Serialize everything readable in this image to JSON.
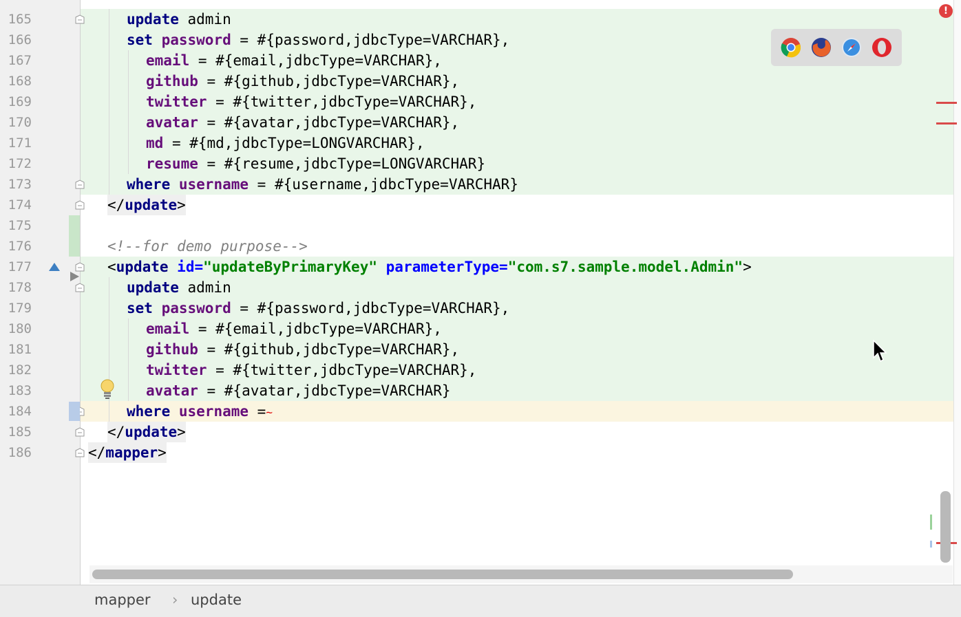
{
  "lines": [
    {
      "n": "165",
      "bg": "hl",
      "indent": 2,
      "tokens": [
        {
          "t": "update",
          "c": "kw"
        },
        {
          "t": " admin",
          "c": ""
        }
      ]
    },
    {
      "n": "166",
      "bg": "hl",
      "indent": 2,
      "tokens": [
        {
          "t": "set",
          "c": "kw"
        },
        {
          "t": " ",
          "c": ""
        },
        {
          "t": "password",
          "c": "col"
        },
        {
          "t": " = #{password,jdbcType=VARCHAR},",
          "c": ""
        }
      ]
    },
    {
      "n": "167",
      "bg": "hl",
      "indent": 3,
      "tokens": [
        {
          "t": "email",
          "c": "col"
        },
        {
          "t": " = #{email,jdbcType=VARCHAR},",
          "c": ""
        }
      ]
    },
    {
      "n": "168",
      "bg": "hl",
      "indent": 3,
      "tokens": [
        {
          "t": "github",
          "c": "col"
        },
        {
          "t": " = #{github,jdbcType=VARCHAR},",
          "c": ""
        }
      ]
    },
    {
      "n": "169",
      "bg": "hl",
      "indent": 3,
      "tokens": [
        {
          "t": "twitter",
          "c": "col"
        },
        {
          "t": " = #{twitter,jdbcType=VARCHAR},",
          "c": ""
        }
      ]
    },
    {
      "n": "170",
      "bg": "hl",
      "indent": 3,
      "tokens": [
        {
          "t": "avatar",
          "c": "col"
        },
        {
          "t": " = #{avatar,jdbcType=VARCHAR},",
          "c": ""
        }
      ]
    },
    {
      "n": "171",
      "bg": "hl",
      "indent": 3,
      "tokens": [
        {
          "t": "md",
          "c": "col"
        },
        {
          "t": " = #{md,jdbcType=LONGVARCHAR},",
          "c": ""
        }
      ]
    },
    {
      "n": "172",
      "bg": "hl",
      "indent": 3,
      "tokens": [
        {
          "t": "resume",
          "c": "col"
        },
        {
          "t": " = #{resume,jdbcType=LONGVARCHAR}",
          "c": ""
        }
      ]
    },
    {
      "n": "173",
      "bg": "hl",
      "indent": 2,
      "tokens": [
        {
          "t": "where",
          "c": "kw"
        },
        {
          "t": " ",
          "c": ""
        },
        {
          "t": "username",
          "c": "col"
        },
        {
          "t": " = #{username,jdbcType=VARCHAR}",
          "c": ""
        }
      ]
    },
    {
      "n": "174",
      "bg": "",
      "indent": 1,
      "tag": true,
      "tokens": [
        {
          "t": "</",
          "c": ""
        },
        {
          "t": "update",
          "c": "kw"
        },
        {
          "t": ">",
          "c": ""
        }
      ]
    },
    {
      "n": "175",
      "bg": "",
      "indent": 0,
      "tokens": []
    },
    {
      "n": "176",
      "bg": "",
      "indent": 1,
      "tokens": [
        {
          "t": "<!--for demo purpose-->",
          "c": "cm"
        }
      ]
    },
    {
      "n": "177",
      "bg": "hl",
      "indent": 1,
      "tokens": [
        {
          "t": "<",
          "c": ""
        },
        {
          "t": "update",
          "c": "kw"
        },
        {
          "t": " ",
          "c": ""
        },
        {
          "t": "id",
          "c": "attr"
        },
        {
          "t": "=",
          "c": "attr"
        },
        {
          "t": "\"updateByPrimaryKey\"",
          "c": "str"
        },
        {
          "t": " ",
          "c": ""
        },
        {
          "t": "parameterType",
          "c": "attr"
        },
        {
          "t": "=",
          "c": "attr"
        },
        {
          "t": "\"com.s7.sample.model.Admin\"",
          "c": "str"
        },
        {
          "t": ">",
          "c": ""
        }
      ]
    },
    {
      "n": "178",
      "bg": "hl",
      "indent": 2,
      "tokens": [
        {
          "t": "update",
          "c": "kw"
        },
        {
          "t": " admin",
          "c": ""
        }
      ]
    },
    {
      "n": "179",
      "bg": "hl",
      "indent": 2,
      "tokens": [
        {
          "t": "set",
          "c": "kw"
        },
        {
          "t": " ",
          "c": ""
        },
        {
          "t": "password",
          "c": "col"
        },
        {
          "t": " = #{password,jdbcType=VARCHAR},",
          "c": ""
        }
      ]
    },
    {
      "n": "180",
      "bg": "hl",
      "indent": 3,
      "tokens": [
        {
          "t": "email",
          "c": "col"
        },
        {
          "t": " = #{email,jdbcType=VARCHAR},",
          "c": ""
        }
      ]
    },
    {
      "n": "181",
      "bg": "hl",
      "indent": 3,
      "tokens": [
        {
          "t": "github",
          "c": "col"
        },
        {
          "t": " = #{github,jdbcType=VARCHAR},",
          "c": ""
        }
      ]
    },
    {
      "n": "182",
      "bg": "hl",
      "indent": 3,
      "tokens": [
        {
          "t": "twitter",
          "c": "col"
        },
        {
          "t": " = #{twitter,jdbcType=VARCHAR},",
          "c": ""
        }
      ]
    },
    {
      "n": "183",
      "bg": "hl",
      "indent": 3,
      "tokens": [
        {
          "t": "avatar",
          "c": "col"
        },
        {
          "t": " = #{avatar,jdbcType=VARCHAR}",
          "c": ""
        }
      ]
    },
    {
      "n": "184",
      "bg": "cur",
      "indent": 2,
      "tokens": [
        {
          "t": "where",
          "c": "kw"
        },
        {
          "t": " ",
          "c": ""
        },
        {
          "t": "username",
          "c": "col"
        },
        {
          "t": " =",
          "c": ""
        }
      ]
    },
    {
      "n": "185",
      "bg": "",
      "indent": 1,
      "tag": true,
      "tokens": [
        {
          "t": "</",
          "c": ""
        },
        {
          "t": "update",
          "c": "kw"
        },
        {
          "t": ">",
          "c": ""
        }
      ]
    },
    {
      "n": "186",
      "bg": "",
      "indent": 0,
      "tag": true,
      "tokens": [
        {
          "t": "</",
          "c": ""
        },
        {
          "t": "mapper",
          "c": "kw"
        },
        {
          "t": ">",
          "c": ""
        }
      ]
    }
  ],
  "browsers": [
    {
      "name": "chrome-icon",
      "color": "#e8b52c"
    },
    {
      "name": "firefox-icon",
      "color": "#e8622b"
    },
    {
      "name": "safari-icon",
      "color": "#3b8fe0"
    },
    {
      "name": "opera-icon",
      "color": "#e0262d"
    }
  ],
  "breadcrumb": {
    "item1": "mapper",
    "sep": "›",
    "item2": "update"
  },
  "error_badge": "!"
}
